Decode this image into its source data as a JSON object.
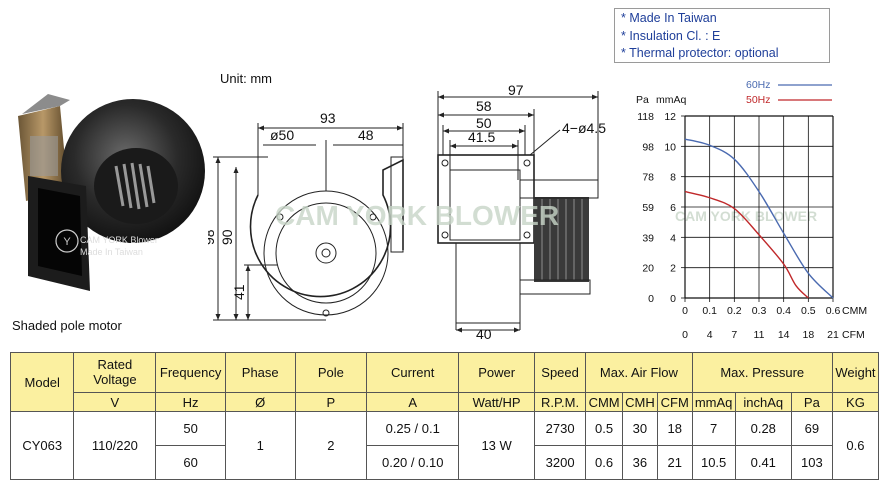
{
  "notes": [
    "* Made In Taiwan",
    "* Insulation Cl. : E",
    "* Thermal protector: optional"
  ],
  "unit_label": "Unit: mm",
  "motor_caption": "Shaded pole motor",
  "photo_label": {
    "brand": "CAM YORK Blower",
    "origin": "Made In Taiwan"
  },
  "watermark": "CAM YORK BLOWER",
  "drawing_side": {
    "dim_width": "93",
    "dim_diameter": "ø50",
    "dim_offset": "48",
    "dim_height": "98",
    "dim_height_inner": "90",
    "dim_outlet": "41"
  },
  "drawing_front": {
    "dim_total": "97",
    "dim_58": "58",
    "dim_50": "50",
    "dim_41_5": "41.5",
    "dim_holes": "4−ø4.5",
    "dim_40": "40"
  },
  "chart_data": {
    "type": "line",
    "title": "",
    "y_units": [
      "Pa",
      "mmAq"
    ],
    "x_units": [
      "CMM",
      "CFM"
    ],
    "series": [
      {
        "name": "60Hz",
        "color": "#4a6ab0",
        "x": [
          0,
          0.1,
          0.2,
          0.3,
          0.4,
          0.5,
          0.6
        ],
        "y": [
          103,
          99,
          90,
          69,
          42,
          16,
          0
        ]
      },
      {
        "name": "50Hz",
        "color": "#c0282a",
        "x": [
          0,
          0.1,
          0.2,
          0.3,
          0.4,
          0.45,
          0.5
        ],
        "y": [
          69,
          65,
          58,
          41,
          22,
          8,
          0
        ]
      }
    ],
    "y_ticks_pa": [
      "118",
      "98",
      "78",
      "59",
      "39",
      "20",
      "0"
    ],
    "y_ticks_mmaq": [
      "12",
      "10",
      "8",
      "6",
      "4",
      "2",
      "0"
    ],
    "x_ticks_cmm": [
      "0",
      "0.1",
      "0.2",
      "0.3",
      "0.4",
      "0.5",
      "0.6"
    ],
    "x_ticks_cfm": [
      "0",
      "4",
      "7",
      "11",
      "14",
      "18",
      "21"
    ],
    "xlim_cmm": [
      0,
      0.6
    ],
    "ylim_pa": [
      0,
      118
    ],
    "grid": true
  },
  "table": {
    "headers": {
      "model": "Model",
      "rated_voltage": "Rated Voltage",
      "frequency": "Frequency",
      "phase": "Phase",
      "pole": "Pole",
      "current": "Current",
      "power": "Power",
      "speed": "Speed",
      "max_air_flow": "Max. Air Flow",
      "max_pressure": "Max. Pressure",
      "weight": "Weight"
    },
    "units": {
      "voltage": "V",
      "frequency": "Hz",
      "phase": "Ø",
      "pole": "P",
      "current": "A",
      "power": "Watt/HP",
      "speed": "R.P.M.",
      "cmm": "CMM",
      "cmh": "CMH",
      "cfm": "CFM",
      "mmaq": "mmAq",
      "inchaq": "inchAq",
      "pa": "Pa",
      "weight": "KG"
    },
    "model": "CY063",
    "voltage": "110/220",
    "phase": "1",
    "pole": "2",
    "power": "13 W",
    "weight": "0.6",
    "rows": [
      {
        "frequency": "50",
        "current": "0.25 / 0.1",
        "speed": "2730",
        "cmm": "0.5",
        "cmh": "30",
        "cfm": "18",
        "mmaq": "7",
        "inchaq": "0.28",
        "pa": "69"
      },
      {
        "frequency": "60",
        "current": "0.20 / 0.10",
        "speed": "3200",
        "cmm": "0.6",
        "cmh": "36",
        "cfm": "21",
        "mmaq": "10.5",
        "inchaq": "0.41",
        "pa": "103"
      }
    ]
  }
}
